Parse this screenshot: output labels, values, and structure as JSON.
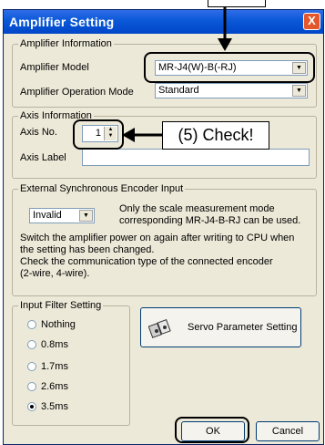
{
  "window": {
    "title": "Amplifier Setting",
    "close_glyph": "X"
  },
  "amplifier_info": {
    "legend": "Amplifier Information",
    "model_label": "Amplifier Model",
    "model_value": "MR-J4(W)-B(-RJ)",
    "mode_label": "Amplifier Operation Mode",
    "mode_value": "Standard"
  },
  "axis_info": {
    "legend": "Axis Information",
    "axis_no_label": "Axis No.",
    "axis_no_value": "1",
    "axis_label_label": "Axis Label",
    "axis_label_value": ""
  },
  "encoder_input": {
    "legend": "External Synchronous Encoder Input",
    "selected": "Invalid",
    "desc_line1": "Only the scale measurement mode",
    "desc_line2": "corresponding MR-J4-B-RJ can be used.",
    "note_line1": "Switch the amplifier power on again after writing to CPU when",
    "note_line2": "the setting has been changed.",
    "note_line3": "Check the communication type of the connected encoder",
    "note_line4": "(2-wire, 4-wire)."
  },
  "input_filter": {
    "legend": "Input Filter Setting",
    "options": [
      "Nothing",
      "0.8ms",
      "1.7ms",
      "2.6ms",
      "3.5ms"
    ],
    "selected": "3.5ms"
  },
  "buttons": {
    "servo_param": "Servo Parameter Setting",
    "ok": "OK",
    "cancel": "Cancel"
  },
  "annotation": {
    "callout": "(5) Check!"
  }
}
